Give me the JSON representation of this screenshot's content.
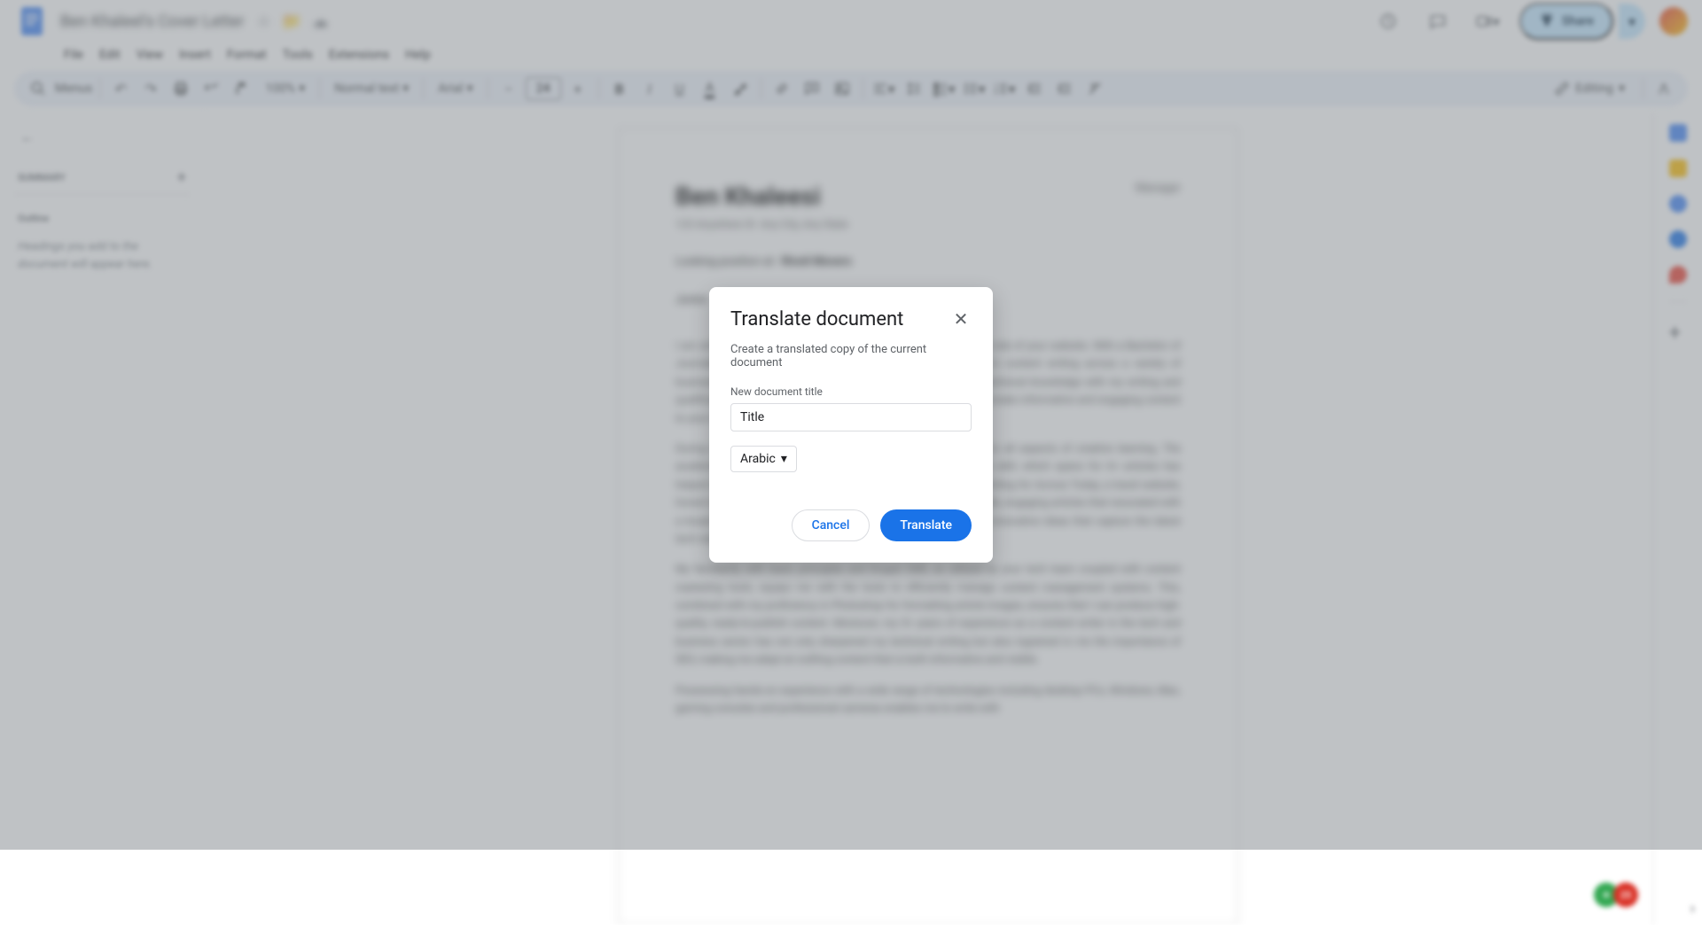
{
  "header": {
    "doc_title": "Ben Khaleel's Cover Letter",
    "share_label": "Share",
    "editing_label": "Editing"
  },
  "menubar": {
    "items": [
      "File",
      "Edit",
      "View",
      "Insert",
      "Format",
      "Tools",
      "Extensions",
      "Help"
    ]
  },
  "toolbar": {
    "search_placeholder": "Menus",
    "zoom_value": "100%",
    "style_value": "Normal text",
    "font_value": "Arial",
    "font_size": "24"
  },
  "outline": {
    "summary_label": "Summary",
    "outline_label": "Outline",
    "hint_text": "Headings you add to the document will appear here."
  },
  "document": {
    "name": "Ben Khaleesi",
    "role": "Manager",
    "contact_addr": "123 Anywhere St",
    "contact_city": "Any City, Any State",
    "job_label": "Looking position at:",
    "job_company": "Rivoli Movers",
    "job_role": "Junior"
  },
  "modal": {
    "title": "Translate document",
    "description": "Create a translated copy of the current document",
    "field_label": "New document title",
    "title_value": "Title",
    "language_value": "Arabic",
    "cancel_label": "Cancel",
    "translate_label": "Translate"
  },
  "float": {
    "red_badge": "25"
  }
}
